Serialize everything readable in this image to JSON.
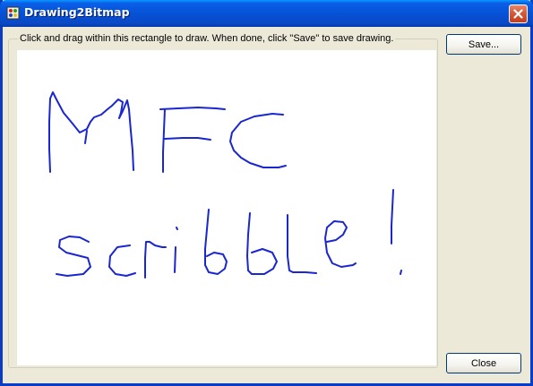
{
  "window": {
    "title": "Drawing2Bitmap",
    "app_icon": "paint-palette-icon",
    "close_icon": "close-icon"
  },
  "instructions": "Click and drag within this rectangle to draw.  When done, click \"Save\" to save drawing.",
  "buttons": {
    "save_label": "Save...",
    "close_label": "Close"
  },
  "drawing": {
    "stroke_color": "#1a26d0",
    "content": "MFC scribble !"
  },
  "colors": {
    "titlebar": "#0552d6",
    "window_bg": "#ece9d8",
    "canvas_bg": "#ffffff"
  }
}
